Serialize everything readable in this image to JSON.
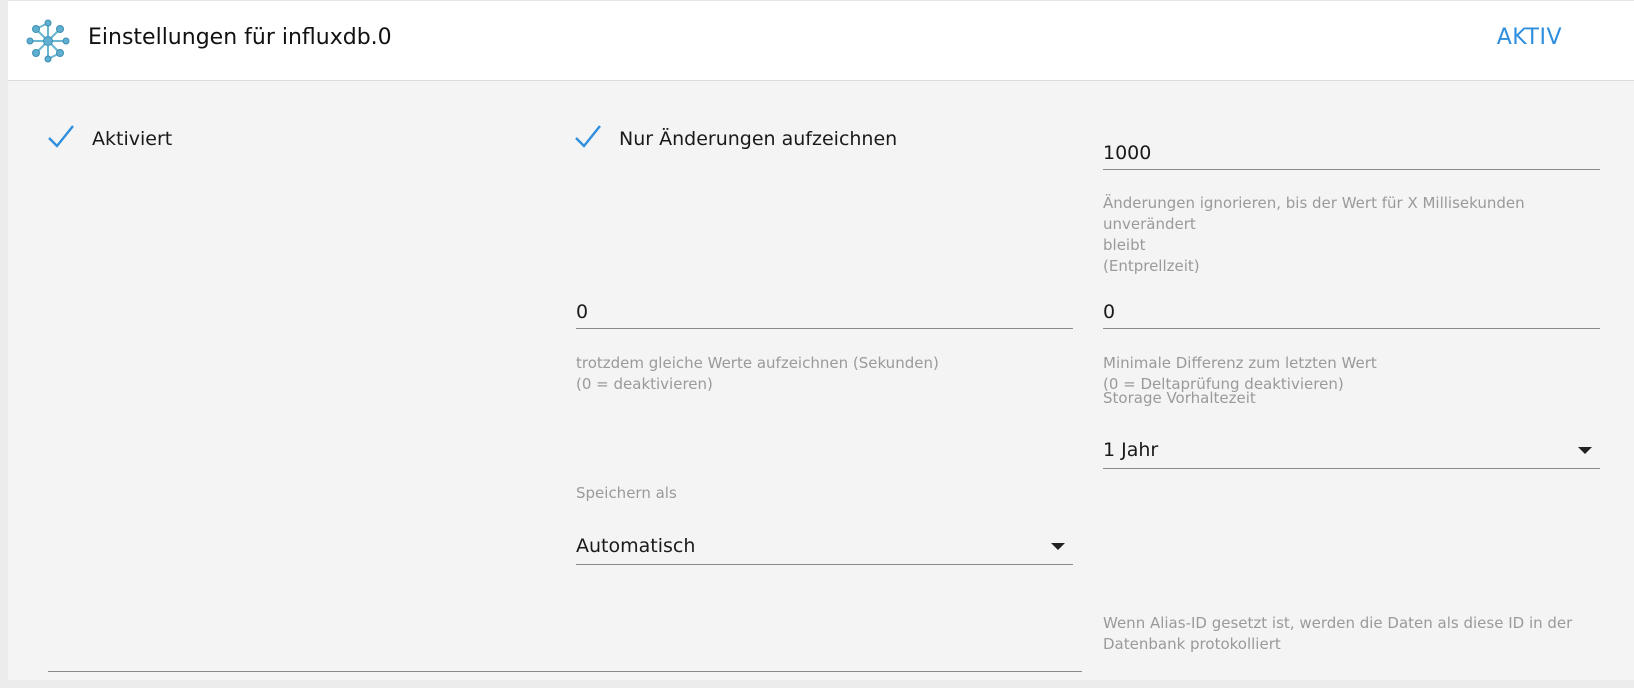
{
  "header": {
    "title": "Einstellungen für influxdb.0",
    "action_label": "AKTIV",
    "logo_icon": "influxdb-molecule-icon"
  },
  "enabled": {
    "label": "Aktiviert",
    "checked": true
  },
  "changes_only": {
    "label": "Nur Änderungen aufzeichnen",
    "checked": true
  },
  "debounce": {
    "value": "1000",
    "helper_line1": "Änderungen ignorieren, bis der Wert für X Millisekunden unverändert",
    "helper_line2": "bleibt",
    "helper_line3": "(Entprellzeit)"
  },
  "same_values": {
    "value": "0",
    "helper_line1": "trotzdem gleiche Werte aufzeichnen (Sekunden)",
    "helper_line2": "(0 = deaktivieren)"
  },
  "min_delta": {
    "value": "0",
    "helper_line1": "Minimale Differenz zum letzten Wert",
    "helper_line2": "(0 = Deltaprüfung deaktivieren)"
  },
  "retention": {
    "label": "Storage Vorhaltezeit",
    "value": "1 Jahr"
  },
  "store_as": {
    "label": "Speichern als",
    "value": "Automatisch"
  },
  "alias": {
    "helper_line1": "Wenn Alias-ID gesetzt ist, werden die Daten als diese ID in der",
    "helper_line2": "Datenbank protokolliert"
  },
  "colors": {
    "accent": "#2f8fde",
    "panel_bg": "#f4f4f4",
    "helper_text": "#9a9a9a"
  }
}
